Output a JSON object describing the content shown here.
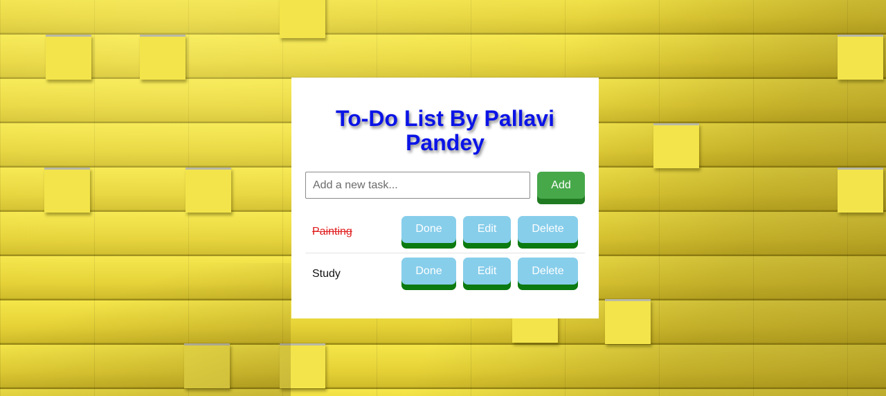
{
  "app": {
    "title": "To-Do List By Pallavi Pandey"
  },
  "new_task": {
    "value": "",
    "placeholder": "Add a new task...",
    "add_label": "Add"
  },
  "tasks": [
    {
      "name": "Painting",
      "completed": true,
      "done_label": "Done",
      "edit_label": "Edit",
      "delete_label": "Delete"
    },
    {
      "name": "Study",
      "completed": false,
      "done_label": "Done",
      "edit_label": "Edit",
      "delete_label": "Delete"
    }
  ],
  "colors": {
    "title": "#0b14e6",
    "add_button": "#47a84a",
    "action_button": "#87ceeb",
    "action_button_shadow": "#0b7a10",
    "completed_task": "#e01b1b",
    "background": "#e9d63c"
  }
}
